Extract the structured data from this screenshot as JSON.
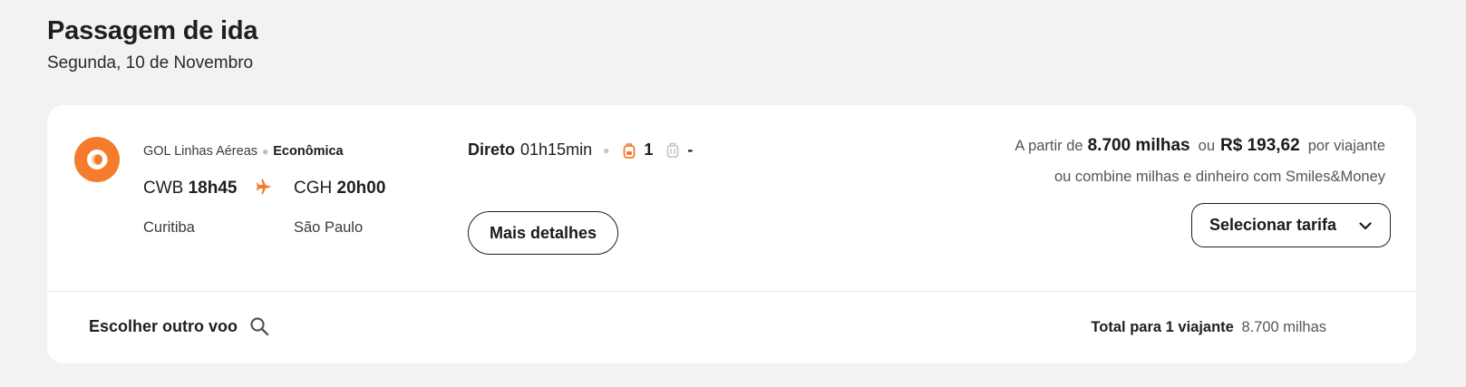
{
  "header": {
    "title": "Passagem de ida",
    "date": "Segunda, 10 de Novembro"
  },
  "flight": {
    "airline": "GOL Linhas Aéreas",
    "cabin": "Econômica",
    "origin": {
      "code": "CWB",
      "time": "18h45",
      "city": "Curitiba"
    },
    "destination": {
      "code": "CGH",
      "time": "20h00",
      "city": "São Paulo"
    },
    "stops": "Direto",
    "duration": "01h15min",
    "carry_on_count": "1",
    "checked_bag_count": "-",
    "details_label": "Mais detalhes"
  },
  "pricing": {
    "from_label": "A partir de",
    "miles": "8.700 milhas",
    "or_label": "ou",
    "money": "R$ 193,62",
    "per_label": "por viajante",
    "combine_label": "ou combine milhas e dinheiro com Smiles&Money",
    "select_label": "Selecionar tarifa"
  },
  "footer": {
    "other_flight_label": "Escolher outro voo",
    "total_label": "Total para 1 viajante",
    "total_value": "8.700 milhas"
  },
  "colors": {
    "accent": "#f47c2c",
    "background": "#f2f2f2",
    "card": "#ffffff"
  },
  "icons": {
    "logo": "gol-logo-icon",
    "plane": "plane-icon",
    "carry_on": "backpack-icon",
    "checked_bag": "suitcase-icon",
    "chevron": "chevron-down-icon",
    "search": "search-icon"
  }
}
